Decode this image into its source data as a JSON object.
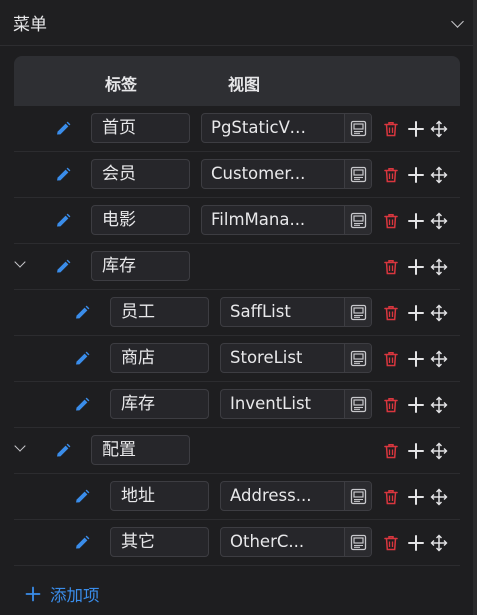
{
  "panel": {
    "title": "菜单"
  },
  "table": {
    "col_label": "标签",
    "col_view": "视图"
  },
  "rows": [
    {
      "label": "首页",
      "view": "PgStaticVi...",
      "level": 0,
      "expandable": false
    },
    {
      "label": "会员",
      "view": "Customer...",
      "level": 0,
      "expandable": false
    },
    {
      "label": "电影",
      "view": "FilmMana...",
      "level": 0,
      "expandable": false
    },
    {
      "label": "库存",
      "view": "",
      "level": 0,
      "expandable": true
    },
    {
      "label": "员工",
      "view": "SaffList",
      "level": 1,
      "expandable": false
    },
    {
      "label": "商店",
      "view": "StoreList",
      "level": 1,
      "expandable": false
    },
    {
      "label": "库存",
      "view": "InventList",
      "level": 1,
      "expandable": false
    },
    {
      "label": "配置",
      "view": "",
      "level": 0,
      "expandable": true
    },
    {
      "label": "地址",
      "view": "Address...",
      "level": 1,
      "expandable": false
    },
    {
      "label": "其它",
      "view": "OtherC...",
      "level": 1,
      "expandable": false
    }
  ],
  "footer": {
    "add_label": "添加项"
  },
  "icons": {
    "edit": "pencil-icon",
    "view_picker": "window-icon",
    "delete": "trash-icon",
    "add": "plus-icon",
    "move": "move-icon",
    "collapse": "chevron-down-icon"
  },
  "colors": {
    "accent": "#3a8dea",
    "danger": "#d9363e",
    "background": "#1e1e20"
  }
}
